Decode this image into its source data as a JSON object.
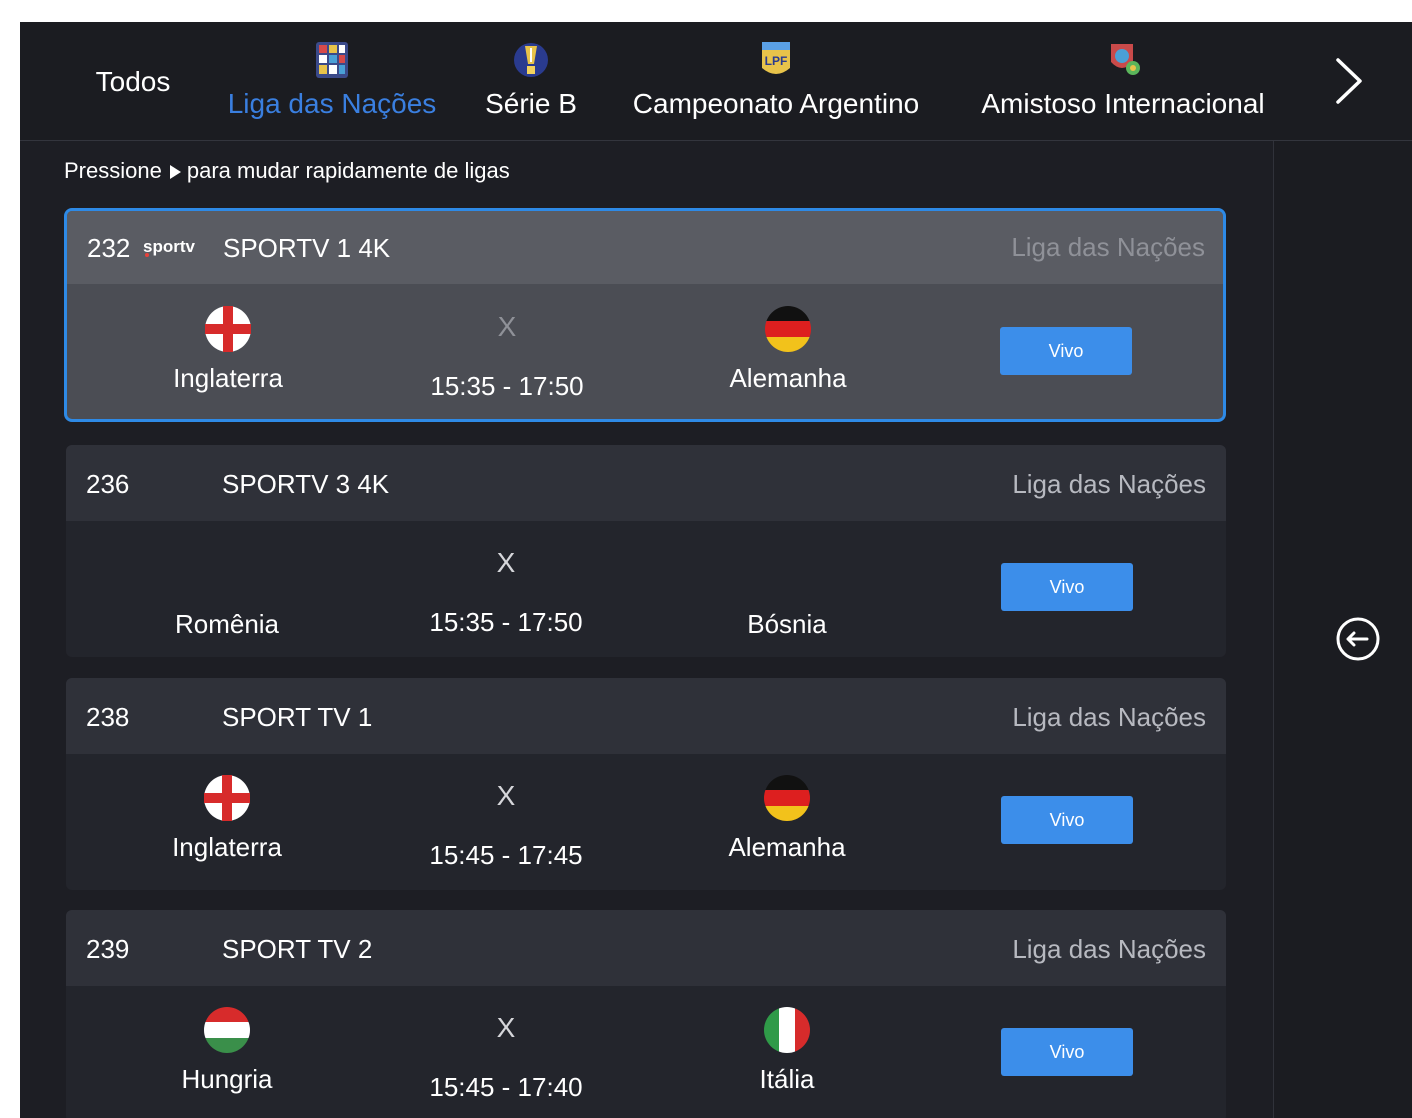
{
  "leagues": [
    {
      "label": "Todos",
      "icon": "none",
      "active": false
    },
    {
      "label": "Liga das Nações",
      "icon": "nations-league-logo",
      "active": true
    },
    {
      "label": "Série B",
      "icon": "serie-b-trophy-logo",
      "active": false
    },
    {
      "label": "Campeonato Argentino",
      "icon": "lpf-logo",
      "active": false
    },
    {
      "label": "Amistoso Internacional",
      "icon": "international-friendly-shield-logo",
      "active": false
    }
  ],
  "hint": {
    "before": "Pressione",
    "after": "para mudar rapidamente de ligas"
  },
  "matches": [
    {
      "channel_number": "232",
      "channel_logo_text": "sportv",
      "channel_name": "SPORTV 1 4K",
      "league": "Liga das Nações",
      "home": "Inglaterra",
      "home_flag": "england-flag",
      "versus": "X",
      "time": "15:35 - 17:50",
      "away": "Alemanha",
      "away_flag": "germany-flag",
      "button": "Vivo",
      "selected": true
    },
    {
      "channel_number": "236",
      "channel_name": "SPORTV 3 4K",
      "league": "Liga das Nações",
      "home": "Romênia",
      "versus": "X",
      "time": "15:35 - 17:50",
      "away": "Bósnia",
      "button": "Vivo",
      "selected": false
    },
    {
      "channel_number": "238",
      "channel_name": "SPORT TV 1",
      "league": "Liga das Nações",
      "home": "Inglaterra",
      "home_flag": "england-flag",
      "versus": "X",
      "time": "15:45 - 17:45",
      "away": "Alemanha",
      "away_flag": "germany-flag",
      "button": "Vivo",
      "selected": false
    },
    {
      "channel_number": "239",
      "channel_name": "SPORT TV 2",
      "league": "Liga das Nações",
      "home": "Hungria",
      "home_flag": "hungary-flag",
      "versus": "X",
      "time": "15:45 - 17:40",
      "away": "Itália",
      "away_flag": "italy-flag",
      "button": "Vivo",
      "selected": false
    }
  ],
  "colors": {
    "background": "#1d1e24",
    "accent": "#3a7fe0",
    "selected_border": "#2e8ae6",
    "live_button": "#3c8eea"
  }
}
